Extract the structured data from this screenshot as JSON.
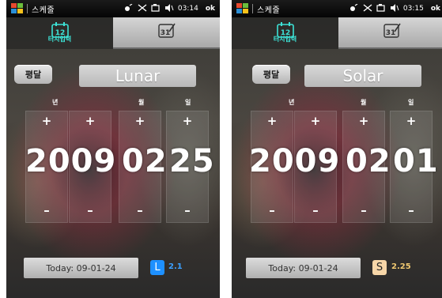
{
  "screens": [
    {
      "status": {
        "app_title": "스케줄",
        "time": "03:14",
        "ok": "ok"
      },
      "tabs": {
        "input_label": "터치입력",
        "calendar_icon_number": "12",
        "todo_icon_number": "31"
      },
      "mode_button": "평달",
      "calendar_type": "Lunar",
      "labels": {
        "year": "년",
        "month": "월",
        "day": "일"
      },
      "plus": "+",
      "minus": "–",
      "date": {
        "year": "2009",
        "month": "02",
        "day": "25"
      },
      "today_button": "Today: 09-01-24",
      "badge": {
        "letter": "L",
        "value": "2.1",
        "bg": "#1e90ff",
        "fg": "#ffffff",
        "value_color": "#3ca0ff"
      }
    },
    {
      "status": {
        "app_title": "스케줄",
        "time": "03:15",
        "ok": "ok"
      },
      "tabs": {
        "input_label": "터치입력",
        "calendar_icon_number": "12",
        "todo_icon_number": "31"
      },
      "mode_button": "평달",
      "calendar_type": "Solar",
      "labels": {
        "year": "년",
        "month": "월",
        "day": "일"
      },
      "plus": "+",
      "minus": "–",
      "date": {
        "year": "2009",
        "month": "02",
        "day": "01"
      },
      "today_button": "Today: 09-01-24",
      "badge": {
        "letter": "S",
        "value": "2.25",
        "bg": "#f7d6a8",
        "fg": "#222222",
        "value_color": "#f0c870"
      }
    }
  ],
  "colors": {
    "accent": "#3de3d7",
    "statusbar": "#0a0a0a"
  }
}
